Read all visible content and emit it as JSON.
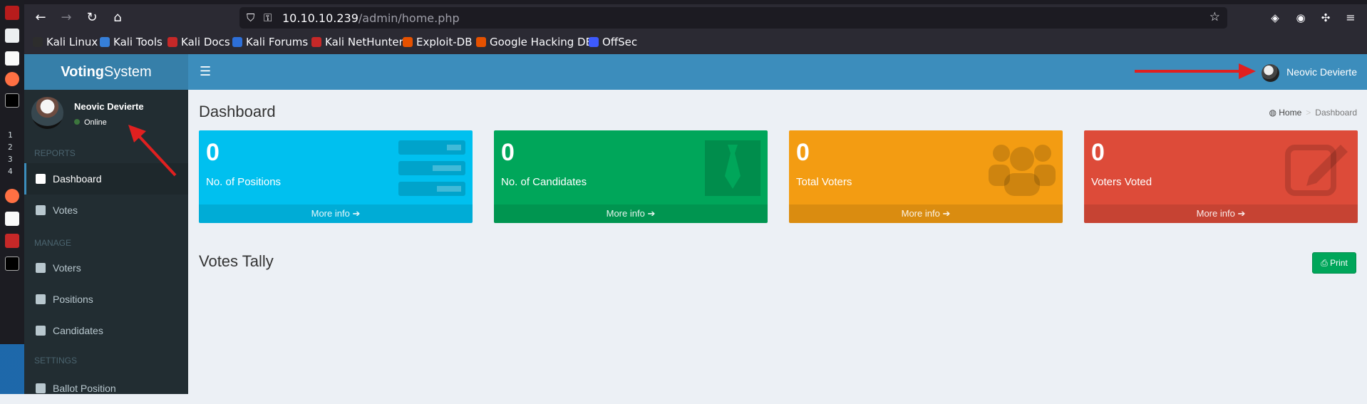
{
  "browser": {
    "url_host": "10.10.10.239",
    "url_path": "/admin/home.php",
    "bookmarks": [
      {
        "label": "Kali Linux",
        "color": "#2d2d2d"
      },
      {
        "label": "Kali Tools",
        "color": "#367fd9"
      },
      {
        "label": "Kali Docs",
        "color": "#c62828"
      },
      {
        "label": "Kali Forums",
        "color": "#2d6fd8"
      },
      {
        "label": "Kali NetHunter",
        "color": "#c62828"
      },
      {
        "label": "Exploit-DB",
        "color": "#e65100"
      },
      {
        "label": "Google Hacking DB",
        "color": "#e65100"
      },
      {
        "label": "OffSec",
        "color": "#3d5afe"
      }
    ]
  },
  "taskbar": {
    "workspaces": [
      "1",
      "2",
      "3",
      "4"
    ]
  },
  "app": {
    "logo_bold": "Voting",
    "logo_rest": "System",
    "user_name": "Neovic Devierte",
    "user_status": "Online"
  },
  "sidebar": {
    "reports_header": "REPORTS",
    "manage_header": "MANAGE",
    "settings_header": "SETTINGS",
    "items": [
      {
        "label": "Dashboard",
        "icon": "dashboard-icon"
      },
      {
        "label": "Votes",
        "icon": "lock-icon"
      },
      {
        "label": "Voters",
        "icon": "users-icon"
      },
      {
        "label": "Positions",
        "icon": "tasks-icon"
      },
      {
        "label": "Candidates",
        "icon": "black-tie-icon"
      },
      {
        "label": "Ballot Position",
        "icon": "file-text-icon"
      }
    ]
  },
  "content": {
    "title": "Dashboard",
    "breadcrumb_home": "Home",
    "breadcrumb_current": "Dashboard",
    "tally_title": "Votes Tally",
    "print_label": "Print",
    "more_info": "More info",
    "boxes": [
      {
        "value": "0",
        "label": "No. of Positions",
        "color": "#00c0ef"
      },
      {
        "value": "0",
        "label": "No. of Candidates",
        "color": "#00a65a"
      },
      {
        "value": "0",
        "label": "Total Voters",
        "color": "#f39c12"
      },
      {
        "value": "0",
        "label": "Voters Voted",
        "color": "#dd4b39"
      }
    ]
  },
  "colors": {
    "header": "#3c8dbc",
    "logo": "#367fa9",
    "sidebar": "#222d32",
    "annotation_arrow": "#e02020"
  }
}
